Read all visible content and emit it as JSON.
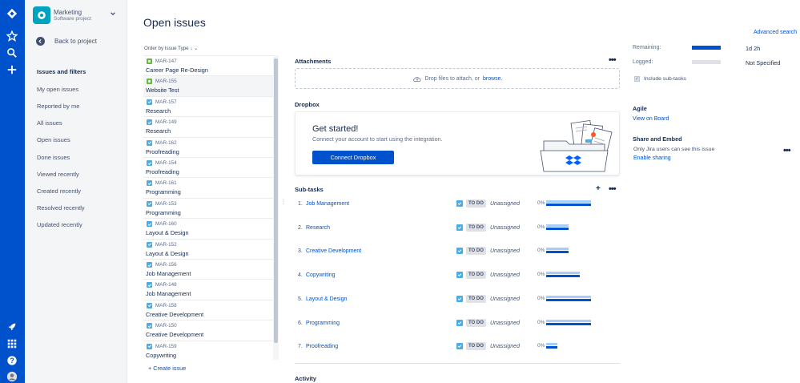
{
  "project": {
    "name": "Marketing",
    "type": "Software project"
  },
  "sidebar": {
    "back_label": "Back to project",
    "section_title": "Issues and filters",
    "items": [
      {
        "label": "My open issues"
      },
      {
        "label": "Reported by me"
      },
      {
        "label": "All issues"
      },
      {
        "label": "Open issues"
      },
      {
        "label": "Done issues"
      },
      {
        "label": "Viewed recently"
      },
      {
        "label": "Created recently"
      },
      {
        "label": "Resolved recently"
      },
      {
        "label": "Updated recently"
      }
    ]
  },
  "page": {
    "title": "Open issues"
  },
  "issue_list": {
    "order_label": "Order by Issue Type",
    "create_label": "+ Create issue",
    "issues": [
      {
        "key": "MAR-147",
        "summary": "Career Page Re-Design",
        "type": "story"
      },
      {
        "key": "MAR-155",
        "summary": "Website Test",
        "type": "story"
      },
      {
        "key": "MAR-157",
        "summary": "Research",
        "type": "task"
      },
      {
        "key": "MAR-149",
        "summary": "Research",
        "type": "task"
      },
      {
        "key": "MAR-162",
        "summary": "Proofreading",
        "type": "task"
      },
      {
        "key": "MAR-154",
        "summary": "Proofreading",
        "type": "task"
      },
      {
        "key": "MAR-161",
        "summary": "Programming",
        "type": "task"
      },
      {
        "key": "MAR-153",
        "summary": "Programming",
        "type": "task"
      },
      {
        "key": "MAR-160",
        "summary": "Layout & Design",
        "type": "task"
      },
      {
        "key": "MAR-152",
        "summary": "Layout & Design",
        "type": "task"
      },
      {
        "key": "MAR-156",
        "summary": "Job Management",
        "type": "task"
      },
      {
        "key": "MAR-148",
        "summary": "Job Management",
        "type": "task"
      },
      {
        "key": "MAR-158",
        "summary": "Creative Development",
        "type": "task"
      },
      {
        "key": "MAR-150",
        "summary": "Creative Development",
        "type": "task"
      },
      {
        "key": "MAR-159",
        "summary": "Copywriting",
        "type": "task"
      }
    ]
  },
  "detail": {
    "attachments": {
      "title": "Attachments",
      "drop_text": "Drop files to attach, or",
      "browse_label": "browse."
    },
    "dropbox": {
      "title": "Dropbox",
      "heading": "Get started!",
      "description": "Connect your account to start using the integration.",
      "button_label": "Connect Dropbox"
    },
    "subtasks": {
      "title": "Sub-tasks",
      "items": [
        {
          "num": "1.",
          "name": "Job Management",
          "status": "TO DO",
          "assignee": "Unassigned",
          "pct": "0%",
          "top_frac": 1.0,
          "bot_frac": 1.0
        },
        {
          "num": "2.",
          "name": "Research",
          "status": "TO DO",
          "assignee": "Unassigned",
          "pct": "0%",
          "top_frac": 0.5,
          "bot_frac": 0.5
        },
        {
          "num": "3.",
          "name": "Creative Development",
          "status": "TO DO",
          "assignee": "Unassigned",
          "pct": "0%",
          "top_frac": 0.5,
          "bot_frac": 0.5
        },
        {
          "num": "4.",
          "name": "Copywriting",
          "status": "TO DO",
          "assignee": "Unassigned",
          "pct": "0%",
          "top_frac": 0.75,
          "bot_frac": 0.75
        },
        {
          "num": "5.",
          "name": "Layout & Design",
          "status": "TO DO",
          "assignee": "Unassigned",
          "pct": "0%",
          "top_frac": 1.0,
          "bot_frac": 1.0
        },
        {
          "num": "6.",
          "name": "Programming",
          "status": "TO DO",
          "assignee": "Unassigned",
          "pct": "0%",
          "top_frac": 1.0,
          "bot_frac": 1.0
        },
        {
          "num": "7.",
          "name": "Proofreading",
          "status": "TO DO",
          "assignee": "Unassigned",
          "pct": "0%",
          "top_frac": 0.25,
          "bot_frac": 0.25
        }
      ]
    },
    "activity": {
      "title": "Activity"
    }
  },
  "right_panel": {
    "advanced_search": "Advanced search",
    "remaining_label": "Remaining:",
    "remaining_value": "1d 2h",
    "logged_label": "Logged:",
    "logged_value": "Not Specified",
    "include_subtasks": "Include sub-tasks",
    "agile_title": "Agile",
    "agile_link": "View on Board",
    "share_title": "Share and Embed",
    "share_text": "Only Jira users can see this issue",
    "share_link": "Enable sharing"
  },
  "colors": {
    "nav": "#0052cc",
    "link": "#0052cc",
    "task": "#4bade8",
    "story": "#63ba3c"
  }
}
